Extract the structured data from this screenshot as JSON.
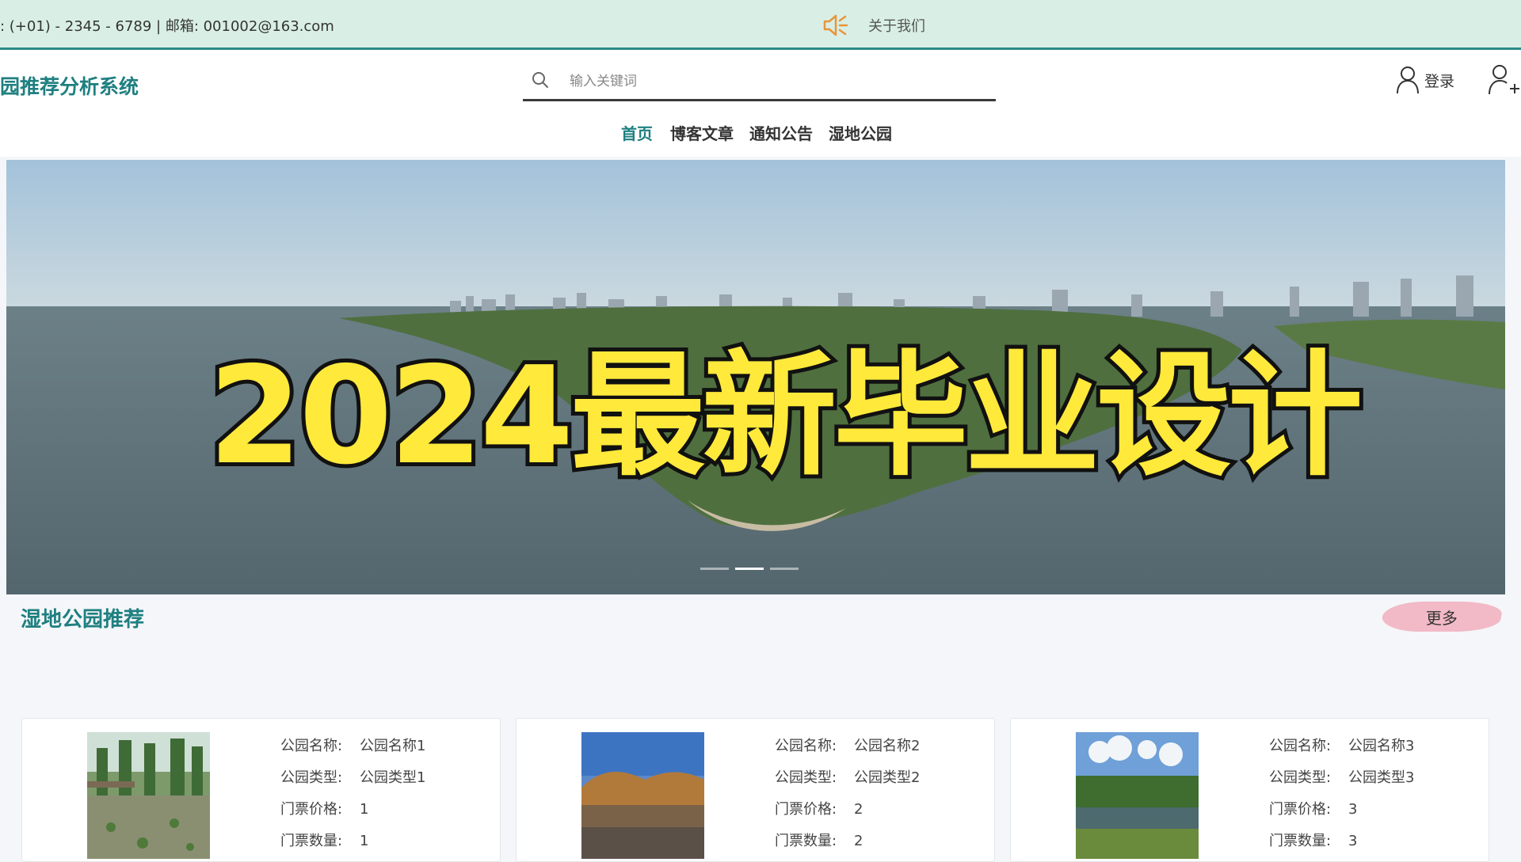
{
  "topbar": {
    "contact": ": (+01) - 2345 - 6789 | 邮箱: 001002@163.com",
    "about": "关于我们",
    "speaker_icon": "speaker-icon"
  },
  "header": {
    "site_title": "园推荐分析系统",
    "search_placeholder": "输入关键词",
    "login_label": "登录",
    "login_icon": "user-icon",
    "register_icon": "user-add-icon"
  },
  "nav": {
    "items": [
      {
        "label": "首页",
        "active": true
      },
      {
        "label": "博客文章",
        "active": false
      },
      {
        "label": "通知公告",
        "active": false
      },
      {
        "label": "湿地公园",
        "active": false
      }
    ]
  },
  "banner": {
    "headline": "2024最新毕业设计",
    "slides": 3,
    "active_slide": 2
  },
  "section": {
    "title": "湿地公园推荐",
    "more_label": "更多"
  },
  "cards": [
    {
      "rows": [
        {
          "key": "公园名称:",
          "value": "公园名称1"
        },
        {
          "key": "公园类型:",
          "value": "公园类型1"
        },
        {
          "key": "门票价格:",
          "value": "1"
        },
        {
          "key": "门票数量:",
          "value": "1"
        }
      ]
    },
    {
      "rows": [
        {
          "key": "公园名称:",
          "value": "公园名称2"
        },
        {
          "key": "公园类型:",
          "value": "公园类型2"
        },
        {
          "key": "门票价格:",
          "value": "2"
        },
        {
          "key": "门票数量:",
          "value": "2"
        }
      ]
    },
    {
      "rows": [
        {
          "key": "公园名称:",
          "value": "公园名称3"
        },
        {
          "key": "公园类型:",
          "value": "公园类型3"
        },
        {
          "key": "门票价格:",
          "value": "3"
        },
        {
          "key": "门票数量:",
          "value": "3"
        }
      ]
    }
  ],
  "colors": {
    "accent": "#1f7f80",
    "topbar_bg": "#d9efe6",
    "banner_text": "#ffe93b",
    "more_bg": "#f2b9c6"
  }
}
